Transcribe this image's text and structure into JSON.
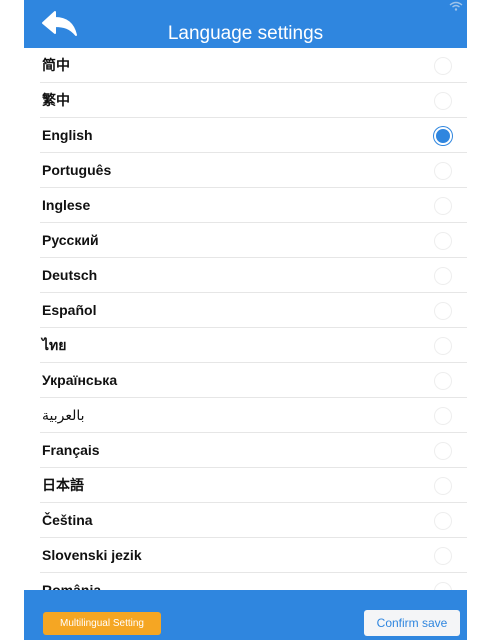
{
  "header": {
    "title": "Language settings",
    "back_icon": "back-arrow-icon",
    "status_icon": "wifi-icon"
  },
  "languages": [
    {
      "label": "简中",
      "selected": false
    },
    {
      "label": "繁中",
      "selected": false
    },
    {
      "label": "English",
      "selected": true
    },
    {
      "label": "Português",
      "selected": false
    },
    {
      "label": "Inglese",
      "selected": false
    },
    {
      "label": "Русский",
      "selected": false
    },
    {
      "label": "Deutsch",
      "selected": false
    },
    {
      "label": "Español",
      "selected": false
    },
    {
      "label": "ไทย",
      "selected": false
    },
    {
      "label": "Українська",
      "selected": false
    },
    {
      "label": "بالعربية",
      "selected": false
    },
    {
      "label": "Français",
      "selected": false
    },
    {
      "label": "日本語",
      "selected": false
    },
    {
      "label": "Čeština",
      "selected": false
    },
    {
      "label": "Slovenski jezik",
      "selected": false
    },
    {
      "label": "România",
      "selected": false
    }
  ],
  "footer": {
    "multilingual_label": "Multilingual Setting",
    "confirm_label": "Confirm save"
  },
  "colors": {
    "primary": "#2f86df",
    "accent": "#f5a623",
    "confirm_bg": "#f4f5f7"
  }
}
